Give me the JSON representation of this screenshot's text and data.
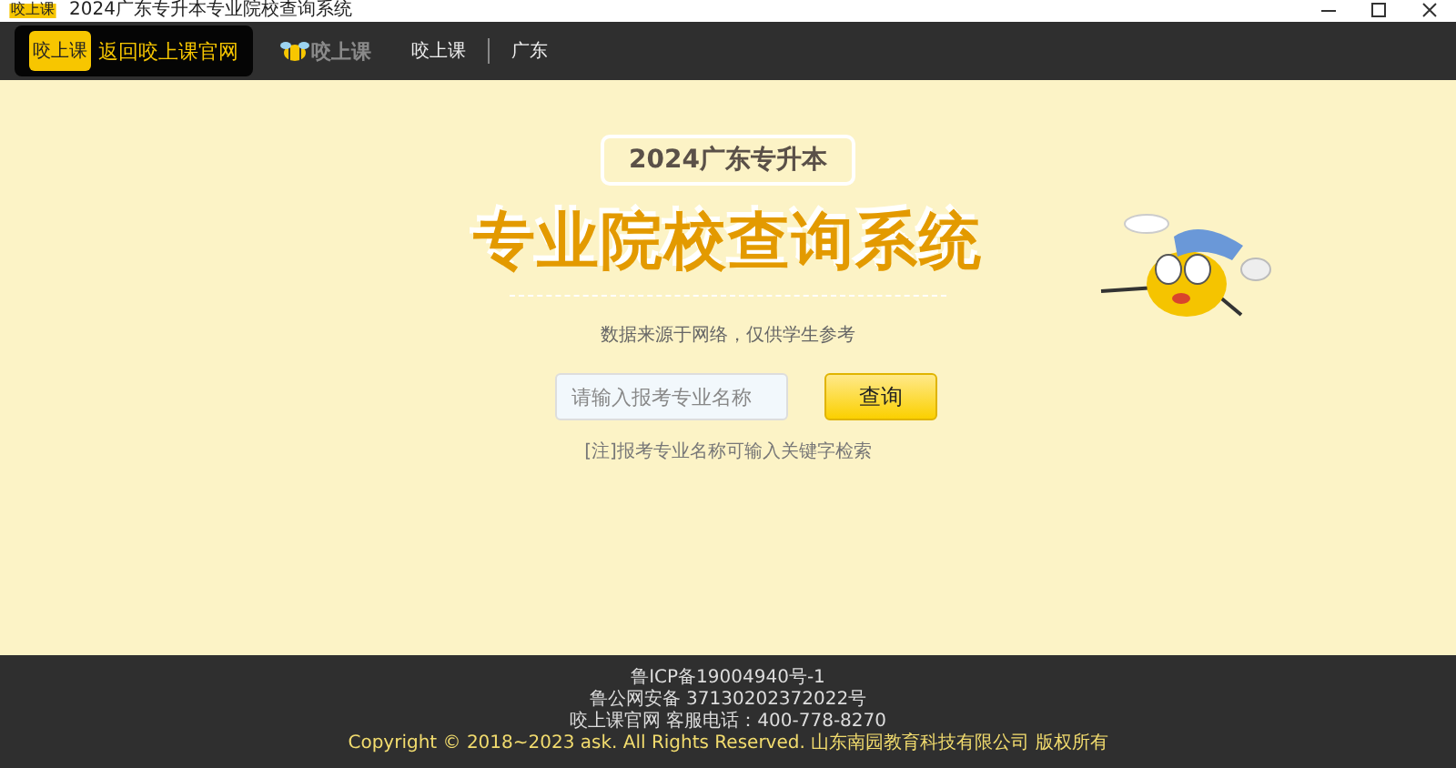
{
  "window": {
    "title": "2024广东专升本专业院校查询系统",
    "app_icon": "咬上课"
  },
  "nav": {
    "back_button": {
      "badge": "咬上课",
      "label": "返回咬上课官网"
    },
    "logo": "咬上课",
    "links": [
      {
        "label": "咬上课"
      },
      {
        "label": "广东"
      }
    ]
  },
  "hero": {
    "badge": "2024广东专升本",
    "title": "专业院校查询系统",
    "subtitle": "数据来源于网络，仅供学生参考",
    "search": {
      "placeholder": "请输入报考专业名称",
      "button": "查询"
    },
    "note": "[注]报考专业名称可输入关键字检索"
  },
  "footer": {
    "lines": [
      "鲁ICP备19004940号-1",
      "鲁公网安备 37130202372022号",
      "咬上课官网 客服电话：400-778-8270"
    ],
    "copyright": "Copyright © 2018~2023 ask. All Rights Reserved. 山东南园教育科技有限公司 版权所有"
  }
}
